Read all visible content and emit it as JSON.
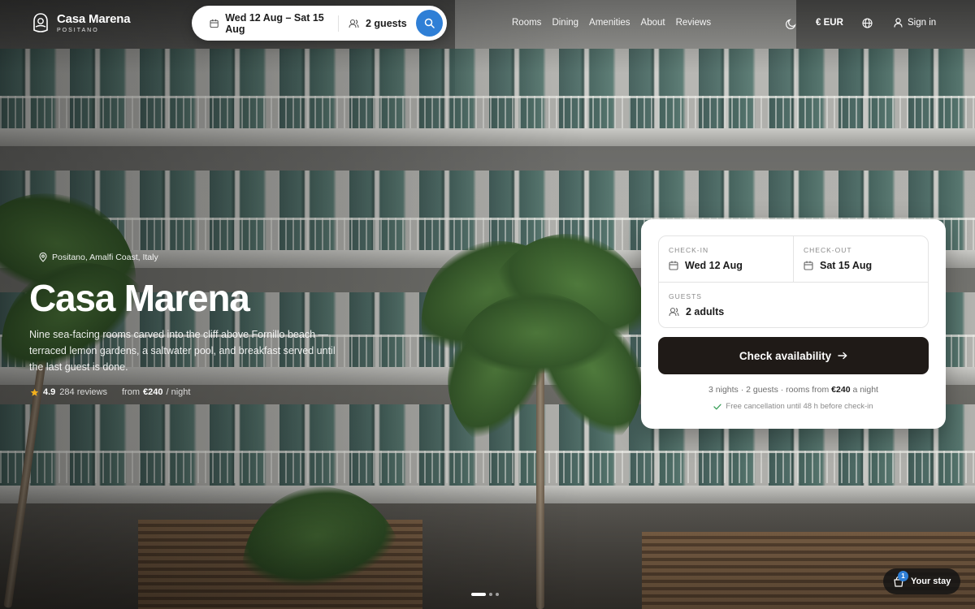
{
  "brand": {
    "name": "Casa Marena",
    "sub": "POSITANO"
  },
  "search": {
    "dates": "Wed 12 Aug – Sat 15 Aug",
    "guests": "2 guests"
  },
  "nav": {
    "links": [
      "Rooms",
      "Dining",
      "Amenities",
      "About",
      "Reviews"
    ]
  },
  "header_right": {
    "currency": "€ EUR",
    "sign_in": "Sign in"
  },
  "hero": {
    "location": "Positano, Amalfi Coast, Italy",
    "title": "Casa Marena",
    "description": "Nine sea-facing rooms carved into the cliff above Fornillo beach — terraced lemon gardens, a saltwater pool, and breakfast served until the last guest is done.",
    "rating": "4.9",
    "reviews": "284 reviews",
    "price_prefix": "from",
    "price": "€240",
    "price_suffix": "/ night"
  },
  "booking": {
    "checkin_label": "CHECK-IN",
    "checkin_value": "Wed 12 Aug",
    "checkout_label": "CHECK-OUT",
    "checkout_value": "Sat 15 Aug",
    "guests_label": "GUESTS",
    "guests_value": "2 adults",
    "cta": "Check availability",
    "summary_prefix": "3 nights · 2 guests · rooms from",
    "summary_price": "€240",
    "summary_suffix": "a night",
    "cancellation": "Free cancellation until 48 h before check-in"
  },
  "slider": {
    "count": 3,
    "active": 1
  },
  "stay": {
    "label": "Your stay",
    "count": "1"
  },
  "colors": {
    "accent": "#2f7fd6",
    "cta": "#1f1a17",
    "card": "#ffffff",
    "rating_star": "#f2b01e",
    "check": "#3aa05a"
  }
}
